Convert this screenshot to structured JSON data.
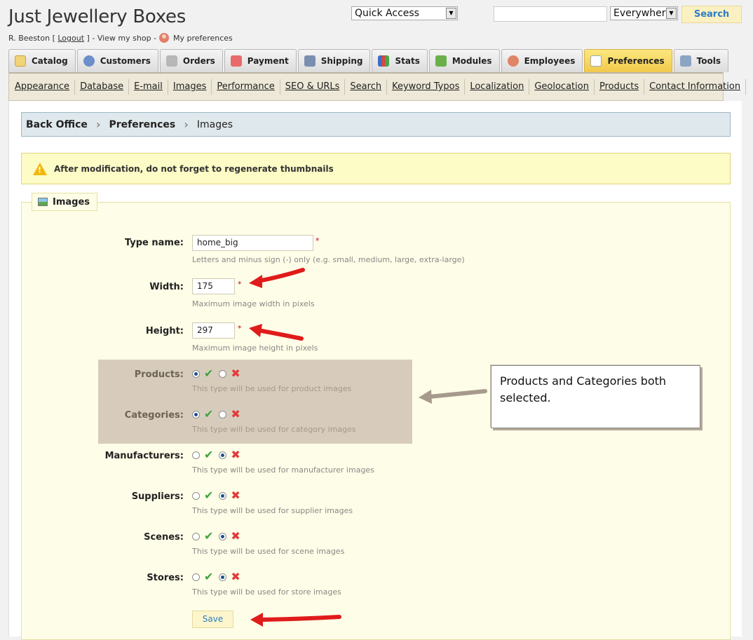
{
  "header": {
    "shop_title": "Just Jewellery Boxes",
    "user_name": "R. Beeston",
    "logout_label": "Logout",
    "view_shop_label": "View my shop",
    "my_preferences_label": "My preferences",
    "quick_access_selected": "Quick Access",
    "search_scope_selected": "Everywhere",
    "search_input_value": "",
    "search_button_label": "Search"
  },
  "tabs": [
    {
      "label": "Catalog",
      "icon": "folder-icon",
      "active": false
    },
    {
      "label": "Customers",
      "icon": "customer-icon",
      "active": false
    },
    {
      "label": "Orders",
      "icon": "cart-icon",
      "active": false
    },
    {
      "label": "Payment",
      "icon": "payment-icon",
      "active": false
    },
    {
      "label": "Shipping",
      "icon": "truck-icon",
      "active": false
    },
    {
      "label": "Stats",
      "icon": "bar-chart-icon",
      "active": false
    },
    {
      "label": "Modules",
      "icon": "puzzle-icon",
      "active": false
    },
    {
      "label": "Employees",
      "icon": "employee-icon",
      "active": false
    },
    {
      "label": "Preferences",
      "icon": "preferences-icon",
      "active": true
    },
    {
      "label": "Tools",
      "icon": "wrench-icon",
      "active": false
    }
  ],
  "subnav": [
    "Appearance",
    "Database",
    "E-mail",
    "Images",
    "Performance",
    "SEO & URLs",
    "Search",
    "Keyword Typos",
    "Localization",
    "Geolocation",
    "Products",
    "Contact Information"
  ],
  "breadcrumb": [
    "Back Office",
    "Preferences",
    "Images"
  ],
  "warning": "After modification, do not forget to regenerate thumbnails",
  "form": {
    "legend": "Images",
    "type_name_label": "Type name:",
    "type_name_value": "home_big",
    "type_name_help": "Letters and minus sign (-) only (e.g. small, medium, large, extra-large)",
    "width_label": "Width:",
    "width_value": "175",
    "width_help": "Maximum image width in pixels",
    "height_label": "Height:",
    "height_value": "297",
    "height_help": "Maximum image height in pixels",
    "required_mark": "*",
    "toggles": [
      {
        "label": "Products:",
        "help": "This type will be used for product images",
        "enabled": true
      },
      {
        "label": "Categories:",
        "help": "This type will be used for category images",
        "enabled": true
      },
      {
        "label": "Manufacturers:",
        "help": "This type will be used for manufacturer images",
        "enabled": false
      },
      {
        "label": "Suppliers:",
        "help": "This type will be used for supplier images",
        "enabled": false
      },
      {
        "label": "Scenes:",
        "help": "This type will be used for scene images",
        "enabled": false
      },
      {
        "label": "Stores:",
        "help": "This type will be used for store images",
        "enabled": false
      }
    ],
    "save_label": "Save"
  },
  "annotation": {
    "callout_text": "Products and Categories both selected.",
    "arrow_color": "#e01b1b",
    "callout_arrow_color": "#a59a8c"
  },
  "colors": {
    "active_tab": "#f1c94b",
    "link_blue": "#2b7ec5",
    "highlight_bg": "#d7ccbc"
  }
}
